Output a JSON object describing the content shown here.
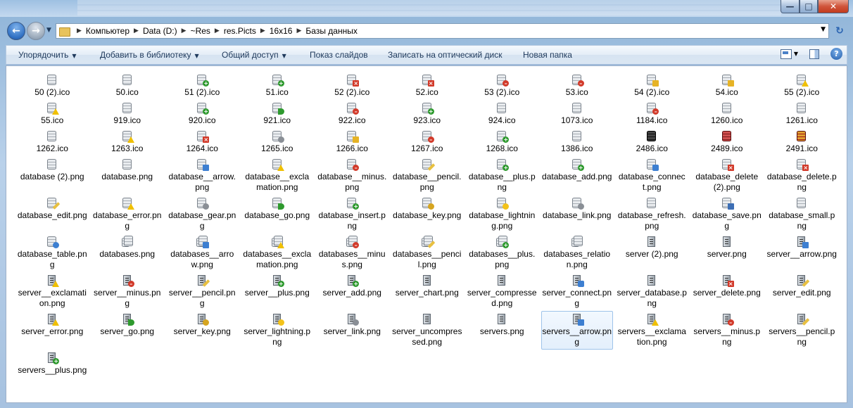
{
  "address": {
    "crumbs": [
      "Компьютер",
      "Data (D:)",
      "~Res",
      "res.Picts",
      "16x16",
      "Базы данных"
    ]
  },
  "toolbar": {
    "organize": "Упорядочить",
    "add_library": "Добавить в библиотеку",
    "share": "Общий доступ",
    "slideshow": "Показ слайдов",
    "burn": "Записать на оптический диск",
    "new_folder": "Новая папка"
  },
  "files": [
    {
      "name": "50 (2).ico",
      "icon": "database-icon"
    },
    {
      "name": "50.ico",
      "icon": "database-icon"
    },
    {
      "name": "51 (2).ico",
      "icon": "database-add-icon"
    },
    {
      "name": "51.ico",
      "icon": "database-add-icon"
    },
    {
      "name": "52 (2).ico",
      "icon": "database-delete-icon"
    },
    {
      "name": "52.ico",
      "icon": "database-delete-icon"
    },
    {
      "name": "53 (2).ico",
      "icon": "database-minus-icon"
    },
    {
      "name": "53.ico",
      "icon": "database-minus-icon"
    },
    {
      "name": "54 (2).ico",
      "icon": "database-lock-icon"
    },
    {
      "name": "54.ico",
      "icon": "database-lock-icon"
    },
    {
      "name": "55 (2).ico",
      "icon": "database-warning-icon"
    },
    {
      "name": "55.ico",
      "icon": "database-warning-icon"
    },
    {
      "name": "919.ico",
      "icon": "database-icon"
    },
    {
      "name": "920.ico",
      "icon": "database-add-icon"
    },
    {
      "name": "921.ico",
      "icon": "database-go-icon"
    },
    {
      "name": "922.ico",
      "icon": "database-minus-icon"
    },
    {
      "name": "923.ico",
      "icon": "database-add-icon"
    },
    {
      "name": "924.ico",
      "icon": "database-refresh-icon"
    },
    {
      "name": "1073.ico",
      "icon": "database-refresh-icon"
    },
    {
      "name": "1184.ico",
      "icon": "database-minus-icon"
    },
    {
      "name": "1260.ico",
      "icon": "database-icon"
    },
    {
      "name": "1261.ico",
      "icon": "database-refresh-icon"
    },
    {
      "name": "1262.ico",
      "icon": "database-icon"
    },
    {
      "name": "1263.ico",
      "icon": "database-warning-icon"
    },
    {
      "name": "1264.ico",
      "icon": "database-delete-icon"
    },
    {
      "name": "1265.ico",
      "icon": "database-gear-icon"
    },
    {
      "name": "1266.ico",
      "icon": "database-lock-icon"
    },
    {
      "name": "1267.ico",
      "icon": "database-minus-icon"
    },
    {
      "name": "1268.ico",
      "icon": "database-add-icon"
    },
    {
      "name": "1386.ico",
      "icon": "database-icon"
    },
    {
      "name": "2486.ico",
      "icon": "database-black-icon"
    },
    {
      "name": "2489.ico",
      "icon": "database-red-icon"
    },
    {
      "name": "2491.ico",
      "icon": "database-red-icon"
    },
    {
      "name": "database (2).png",
      "icon": "database-icon"
    },
    {
      "name": "database.png",
      "icon": "database-icon"
    },
    {
      "name": "database__arrow.png",
      "icon": "database-arrow-icon"
    },
    {
      "name": "database__exclamation.png",
      "icon": "database-warning-icon"
    },
    {
      "name": "database__minus.png",
      "icon": "database-minus-icon"
    },
    {
      "name": "database__pencil.png",
      "icon": "database-edit-icon"
    },
    {
      "name": "database__plus.png",
      "icon": "database-add-icon"
    },
    {
      "name": "database_add.png",
      "icon": "database-add-icon"
    },
    {
      "name": "database_connect.png",
      "icon": "database-connect-icon"
    },
    {
      "name": "database_delete (2).png",
      "icon": "database-delete-icon"
    },
    {
      "name": "database_delete.png",
      "icon": "database-delete-icon"
    },
    {
      "name": "database_edit.png",
      "icon": "database-edit-icon"
    },
    {
      "name": "database_error.png",
      "icon": "database-warning-icon"
    },
    {
      "name": "database_gear.png",
      "icon": "database-gear-icon"
    },
    {
      "name": "database_go.png",
      "icon": "database-go-icon"
    },
    {
      "name": "database_insert.png",
      "icon": "database-add-icon"
    },
    {
      "name": "database_key.png",
      "icon": "database-key-icon"
    },
    {
      "name": "database_lightning.png",
      "icon": "database-lightning-icon"
    },
    {
      "name": "database_link.png",
      "icon": "database-link-icon"
    },
    {
      "name": "database_refresh.png",
      "icon": "database-refresh-icon"
    },
    {
      "name": "database_save.png",
      "icon": "database-save-icon"
    },
    {
      "name": "database_small.png",
      "icon": "database-icon"
    },
    {
      "name": "database_table.png",
      "icon": "database-table-icon"
    },
    {
      "name": "databases.png",
      "icon": "databases-icon"
    },
    {
      "name": "databases__arrow.png",
      "icon": "databases-arrow-icon"
    },
    {
      "name": "databases__exclamation.png",
      "icon": "databases-warning-icon"
    },
    {
      "name": "databases__minus.png",
      "icon": "databases-minus-icon"
    },
    {
      "name": "databases__pencil.png",
      "icon": "databases-edit-icon"
    },
    {
      "name": "databases__plus.png",
      "icon": "databases-add-icon"
    },
    {
      "name": "databases_relation.png",
      "icon": "databases-icon"
    },
    {
      "name": "server (2).png",
      "icon": "server-icon"
    },
    {
      "name": "server.png",
      "icon": "server-icon"
    },
    {
      "name": "server__arrow.png",
      "icon": "server-arrow-icon"
    },
    {
      "name": "server__exclamation.png",
      "icon": "server-warning-icon"
    },
    {
      "name": "server__minus.png",
      "icon": "server-minus-icon"
    },
    {
      "name": "server__pencil.png",
      "icon": "server-edit-icon"
    },
    {
      "name": "server__plus.png",
      "icon": "server-add-icon"
    },
    {
      "name": "server_add.png",
      "icon": "server-add-icon"
    },
    {
      "name": "server_chart.png",
      "icon": "server-icon"
    },
    {
      "name": "server_compressed.png",
      "icon": "server-icon"
    },
    {
      "name": "server_connect.png",
      "icon": "server-connect-icon"
    },
    {
      "name": "server_database.png",
      "icon": "server-icon"
    },
    {
      "name": "server_delete.png",
      "icon": "server-delete-icon"
    },
    {
      "name": "server_edit.png",
      "icon": "server-edit-icon"
    },
    {
      "name": "server_error.png",
      "icon": "server-warning-icon"
    },
    {
      "name": "server_go.png",
      "icon": "server-go-icon"
    },
    {
      "name": "server_key.png",
      "icon": "server-key-icon"
    },
    {
      "name": "server_lightning.png",
      "icon": "server-lightning-icon"
    },
    {
      "name": "server_link.png",
      "icon": "server-link-icon"
    },
    {
      "name": "server_uncompressed.png",
      "icon": "server-icon"
    },
    {
      "name": "servers.png",
      "icon": "servers-icon"
    },
    {
      "name": "servers__arrow.png",
      "icon": "servers-arrow-icon",
      "selected": true
    },
    {
      "name": "servers__exclamation.png",
      "icon": "servers-warning-icon"
    },
    {
      "name": "servers__minus.png",
      "icon": "servers-minus-icon"
    },
    {
      "name": "servers__pencil.png",
      "icon": "servers-edit-icon"
    },
    {
      "name": "servers__plus.png",
      "icon": "servers-add-icon"
    }
  ],
  "colors": {
    "accent": "#3d7fd1",
    "selection_bg": "#e3effc",
    "selection_border": "#9ec3ea"
  }
}
